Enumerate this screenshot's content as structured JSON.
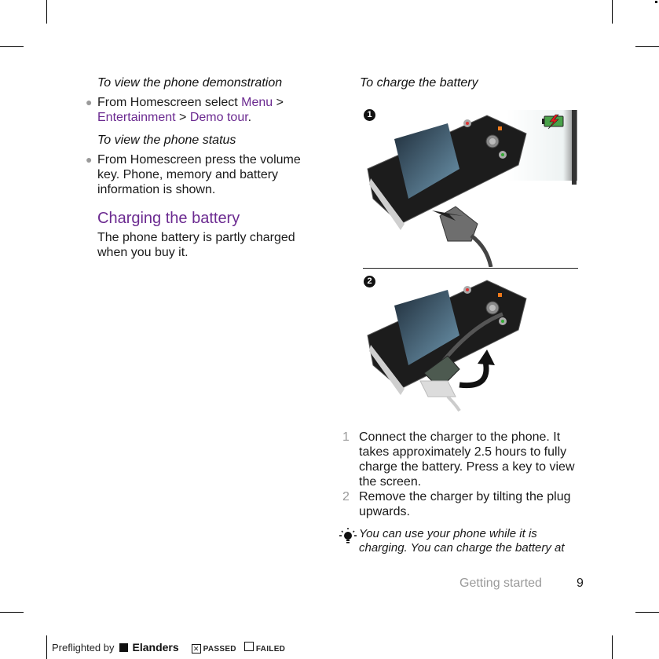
{
  "left_column": {
    "heading_demo": "To view the phone demonstration",
    "demo_step": {
      "prefix": "From Homescreen select ",
      "menu": "Menu",
      "sep1": " > ",
      "entertainment": "Entertainment",
      "sep2": " > ",
      "demo_tour": "Demo tour",
      "suffix": "."
    },
    "heading_status": "To view the phone status",
    "status_step": "From Homescreen press the volume key. Phone, memory and battery information is shown.",
    "section_title": "Charging the battery",
    "section_body": "The phone battery is partly charged when you buy it."
  },
  "right_column": {
    "heading_charge": "To charge the battery",
    "figure_badges": [
      "1",
      "2"
    ],
    "steps": [
      {
        "num": "1",
        "text": "Connect the charger to the phone. It takes approximately 2.5 hours to fully charge the battery. Press a key to view the screen."
      },
      {
        "num": "2",
        "text": "Remove the charger by tilting the plug upwards."
      }
    ],
    "tip": "You can use your phone while it is charging. You can charge the battery at"
  },
  "footer": {
    "section": "Getting started",
    "page": "9"
  },
  "preflight": {
    "label": "Preflighted by",
    "brand": "Elanders",
    "passed": "PASSED",
    "failed": "FAILED",
    "passed_mark": "✕"
  },
  "colors": {
    "accent": "#6b2a90",
    "muted": "#9a9a9a",
    "text": "#1a1a1a"
  }
}
